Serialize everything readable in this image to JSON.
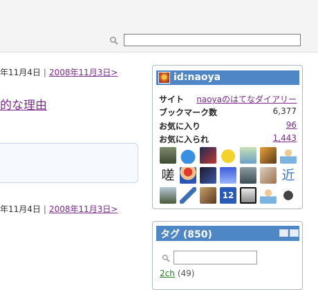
{
  "search": {
    "value": ""
  },
  "nav": {
    "current": "年11月4日",
    "separator": "|",
    "prev": "2008年11月3日>"
  },
  "entry": {
    "title_tail": "的な理由"
  },
  "profile": {
    "user_id": "id:naoya",
    "rows": [
      {
        "label": "サイト",
        "value": "naoyaのはてなダイアリー"
      },
      {
        "label": "ブックマーク数",
        "value": "6,377"
      },
      {
        "label": "お気に入り",
        "value": "96"
      },
      {
        "label": "お気に入られ",
        "value": "1,443"
      }
    ],
    "favorites": [
      "avatar-icon",
      "slime-icon",
      "avatar-icon",
      "pikachu-icon",
      "avatar-icon",
      "avatar-icon",
      "user-icon",
      "kanji-icon",
      "mario-icon",
      "avatar-icon",
      "avatar-icon",
      "avatar-icon",
      "avatar-icon",
      "kanji-icon",
      "avatar-icon",
      "brush-icon",
      "avatar-icon",
      "jersey-icon",
      "avatar-icon",
      "user-icon",
      "avatar-icon"
    ],
    "favorite_glyphs": {
      "kanji1": "嗟",
      "kanji2": "近",
      "jersey": "12"
    }
  },
  "tags": {
    "title": "タグ (850)",
    "filter_value": "",
    "items": [
      {
        "name": "2ch",
        "count": "(49)"
      }
    ]
  },
  "colors": {
    "accent": "#4f86c6",
    "link": "#7b2a8c",
    "tag": "#2a7a2a"
  }
}
